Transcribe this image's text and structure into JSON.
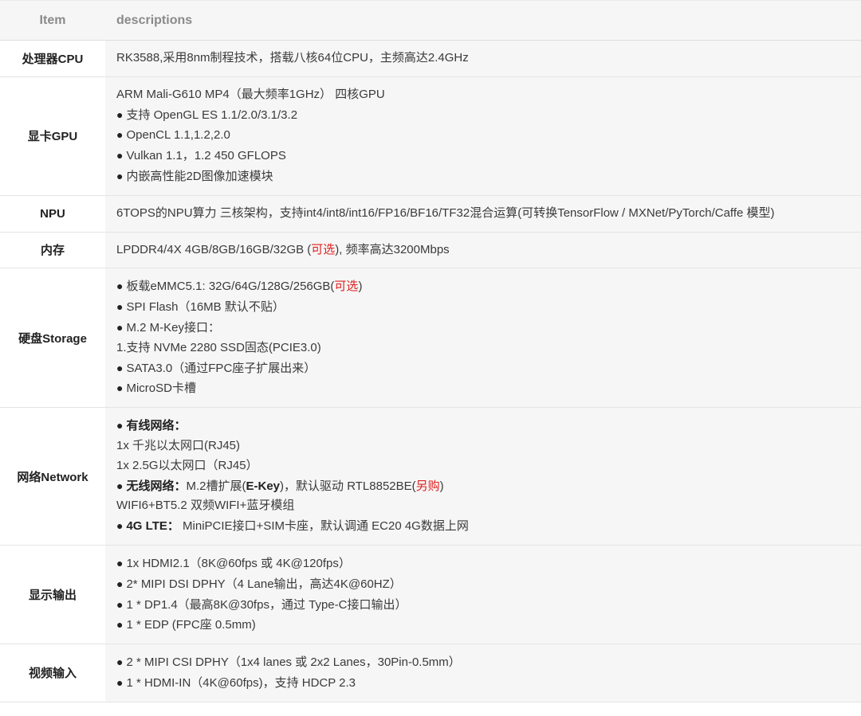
{
  "header": {
    "item": "Item",
    "desc": "descriptions"
  },
  "rows": [
    {
      "item": "处理器CPU",
      "lines": [
        [
          {
            "t": "RK3588,采用8nm制程技术，搭载八核64位CPU，主频高达2.4GHz"
          }
        ]
      ]
    },
    {
      "item": "显卡GPU",
      "lines": [
        [
          {
            "t": "ARM Mali-G610 MP4（最大频率1GHz） 四核GPU"
          }
        ],
        [
          {
            "bullet": "●"
          },
          {
            "t": "支持 OpenGL ES 1.1/2.0/3.1/3.2"
          }
        ],
        [
          {
            "bullet": "●"
          },
          {
            "t": "OpenCL 1.1,1.2,2.0"
          }
        ],
        [
          {
            "bullet": "●"
          },
          {
            "t": "Vulkan 1.1，1.2 450 GFLOPS"
          }
        ],
        [
          {
            "bullet": "●"
          },
          {
            "t": "内嵌高性能2D图像加速模块"
          }
        ]
      ]
    },
    {
      "item": "NPU",
      "lines": [
        [
          {
            "t": "6TOPS的NPU算力 三核架构，支持int4/int8/int16/FP16/BF16/TF32混合运算(可转换TensorFlow / MXNet/PyTorch/Caffe 模型)"
          }
        ]
      ]
    },
    {
      "item": "内存",
      "lines": [
        [
          {
            "t": "LPDDR4/4X 4GB/8GB/16GB/32GB ("
          },
          {
            "t": "可选",
            "s": "red"
          },
          {
            "t": "), 频率高达3200Mbps"
          }
        ]
      ]
    },
    {
      "item": "硬盘Storage",
      "lines": [
        [
          {
            "bullet": "●"
          },
          {
            "t": "板载eMMC5.1: 32G/64G/128G/256GB("
          },
          {
            "t": "可选",
            "s": "red"
          },
          {
            "t": ")"
          }
        ],
        [
          {
            "bullet": "●"
          },
          {
            "t": "SPI Flash（16MB 默认不贴）"
          }
        ],
        [
          {
            "bullet": "●"
          },
          {
            "t": "M.2 M-Key接口："
          }
        ],
        [
          {
            "t": "1.支持 NVMe 2280 SSD固态(PCIE3.0)"
          }
        ],
        [
          {
            "bullet": "●"
          },
          {
            "t": "SATA3.0（通过FPC座子扩展出来）"
          }
        ],
        [
          {
            "bullet": "●"
          },
          {
            "t": "MicroSD卡槽"
          }
        ]
      ]
    },
    {
      "item": "网络Network",
      "lines": [
        [
          {
            "bullet": "●"
          },
          {
            "t": "有线网络：",
            "s": "b"
          }
        ],
        [
          {
            "t": "1x 千兆以太网口(RJ45)"
          }
        ],
        [
          {
            "t": "1x 2.5G以太网口（RJ45）"
          }
        ],
        [
          {
            "bullet": "●"
          },
          {
            "t": "无线网络：",
            "s": "b"
          },
          {
            "t": "M.2槽扩展("
          },
          {
            "t": "E-Key",
            "s": "b"
          },
          {
            "t": ")，默认驱动 RTL8852BE("
          },
          {
            "t": "另购",
            "s": "red"
          },
          {
            "t": ")"
          }
        ],
        [
          {
            "t": "WIFI6+BT5.2 双频WIFI+蓝牙模组"
          }
        ],
        [
          {
            "bullet": "●"
          },
          {
            "t": "4G LTE：",
            "s": "b"
          },
          {
            "t": " MiniPCIE接口+SIM卡座，默认调通 EC20 4G数据上网"
          }
        ]
      ]
    },
    {
      "item": "显示输出",
      "lines": [
        [
          {
            "bullet": "●"
          },
          {
            "t": "1x HDMI2.1（8K@60fps 或 4K@120fps）"
          }
        ],
        [
          {
            "bullet": "●"
          },
          {
            "t": "2* MIPI DSI DPHY（4 Lane输出，高达4K@60HZ）"
          }
        ],
        [
          {
            "bullet": "●"
          },
          {
            "t": "1 * DP1.4（最高8K@30fps，通过 Type-C接口输出）"
          }
        ],
        [
          {
            "bullet": "●"
          },
          {
            "t": "1 * EDP (FPC座 0.5mm)"
          }
        ]
      ]
    },
    {
      "item": "视频输入",
      "lines": [
        [
          {
            "bullet": "●"
          },
          {
            "t": "2 * MIPI CSI DPHY（1x4 lanes 或 2x2 Lanes，30Pin-0.5mm）"
          }
        ],
        [
          {
            "bullet": "●"
          },
          {
            "t": "1 * HDMI-IN（4K@60fps)，支持 HDCP 2.3"
          }
        ]
      ]
    }
  ]
}
